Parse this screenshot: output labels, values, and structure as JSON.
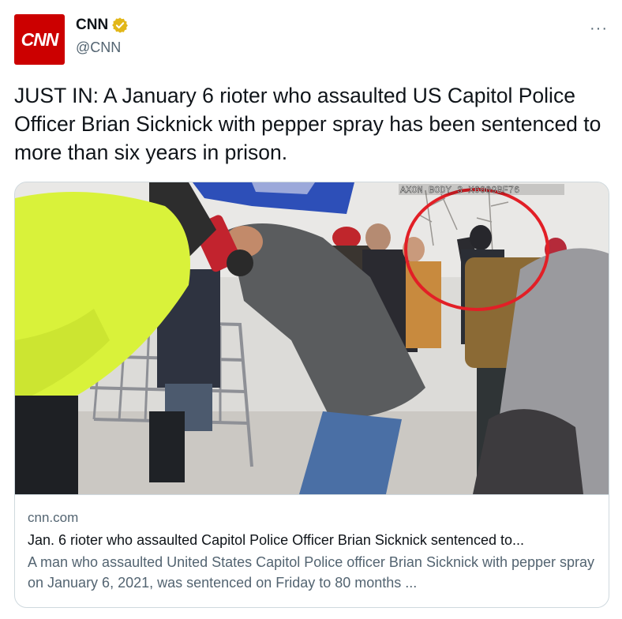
{
  "tweet": {
    "author": {
      "display_name": "CNN",
      "handle": "@CNN",
      "avatar_logo": "CNN",
      "verified_badge": "gold-check-badge-icon",
      "brand_color": "#cc0000",
      "badge_color": "#e2b719"
    },
    "more_menu_icon": "···",
    "text": "JUST IN: A January 6 rioter who assaulted US Capitol Police Officer Brian Sicknick with pepper spray has been sentenced to more than six years in prison.",
    "card": {
      "image_overlay_text": "AXON BODY 3 X6009BF76",
      "domain": "cnn.com",
      "title": "Jan. 6 rioter who assaulted Capitol Police Officer Brian Sicknick sentenced to...",
      "description": "A man who assaulted United States Capitol Police officer Brian Sicknick with pepper spray on January 6, 2021, was sentenced on Friday to 80 months ..."
    }
  }
}
